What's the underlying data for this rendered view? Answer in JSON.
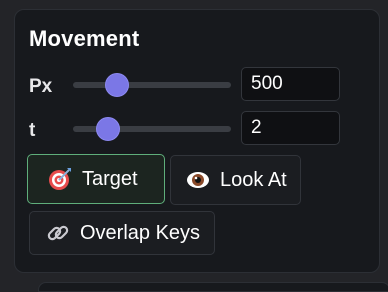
{
  "panel": {
    "title": "Movement"
  },
  "sliders": [
    {
      "label": "Px",
      "value": "500",
      "level": 0.28
    },
    {
      "label": "t",
      "value": "2",
      "level": 0.22
    }
  ],
  "buttons": {
    "target": "Target",
    "look_at": "Look At",
    "overlap_keys": "Overlap Keys"
  },
  "colors": {
    "accent": "#7b77e6",
    "active_border": "#5fae7b",
    "panel_bg": "#17191d"
  },
  "icons": {
    "target": "target-icon",
    "look_at": "eye-icon",
    "overlap_keys": "link-icon"
  }
}
